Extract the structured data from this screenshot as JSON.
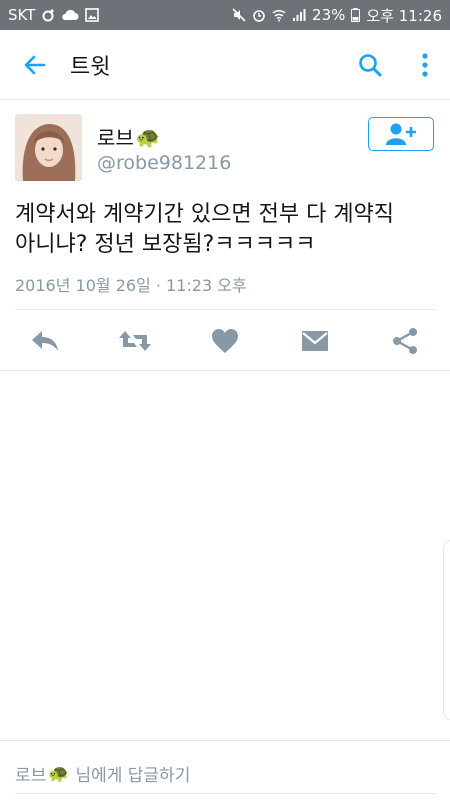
{
  "status_bar": {
    "carrier": "SKT",
    "battery": "23%",
    "time": "오후 11:26"
  },
  "app_bar": {
    "title": "트윗",
    "back_icon": "arrow-left-icon",
    "search_icon": "search-icon",
    "menu_icon": "more-vertical-icon"
  },
  "tweet": {
    "display_name": "로브",
    "name_emoji": "🐢",
    "handle": "@robe981216",
    "text_line1": "계약서와 계약기간 있으면 전부 다 계약직",
    "text_line2": "아니냐? 정년 보장됨?ㅋㅋㅋㅋㅋ",
    "timestamp": "2016년 10월 26일 · 11:23 오후"
  },
  "actions": [
    "reply-icon",
    "retweet-icon",
    "like-icon",
    "message-icon",
    "share-icon"
  ],
  "reply_bar": {
    "name": "로브",
    "emoji": "🐢",
    "suffix": "님에게 답글하기"
  },
  "colors": {
    "accent": "#1da1f2",
    "icon_gray": "#8899a6",
    "status_bar": "#6e7177",
    "text": "#14171a"
  }
}
